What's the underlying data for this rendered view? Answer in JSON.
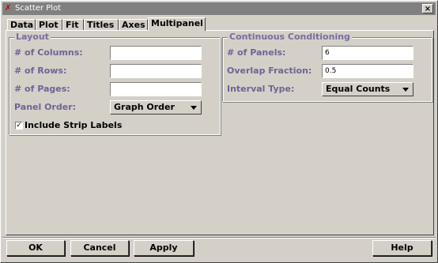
{
  "window": {
    "title": "Scatter Plot",
    "icon": "app-icon"
  },
  "tabs": [
    "Data",
    "Plot",
    "Fit",
    "Titles",
    "Axes",
    "Multipanel"
  ],
  "active_tab": "Multipanel",
  "layout": {
    "title": "Layout",
    "columns_label": "# of Columns:",
    "rows_label": "# of Rows:",
    "pages_label": "# of Pages:",
    "columns_value": "",
    "rows_value": "",
    "pages_value": "",
    "panel_order_label": "Panel Order:",
    "panel_order_value": "Graph Order",
    "include_strip_label": "Include Strip Labels",
    "include_strip_checked": true
  },
  "conditioning": {
    "title": "Continuous Conditioning",
    "panels_label": "# of Panels:",
    "panels_value": "6",
    "overlap_label": "Overlap Fraction:",
    "overlap_value": "0.5",
    "interval_label": "Interval Type:",
    "interval_value": "Equal Counts"
  },
  "buttons": {
    "ok": "OK",
    "cancel": "Cancel",
    "apply": "Apply",
    "help": "Help"
  },
  "colors": {
    "face": "#d4d0c8",
    "label": "#6f6395",
    "titlebar": "#808080"
  }
}
